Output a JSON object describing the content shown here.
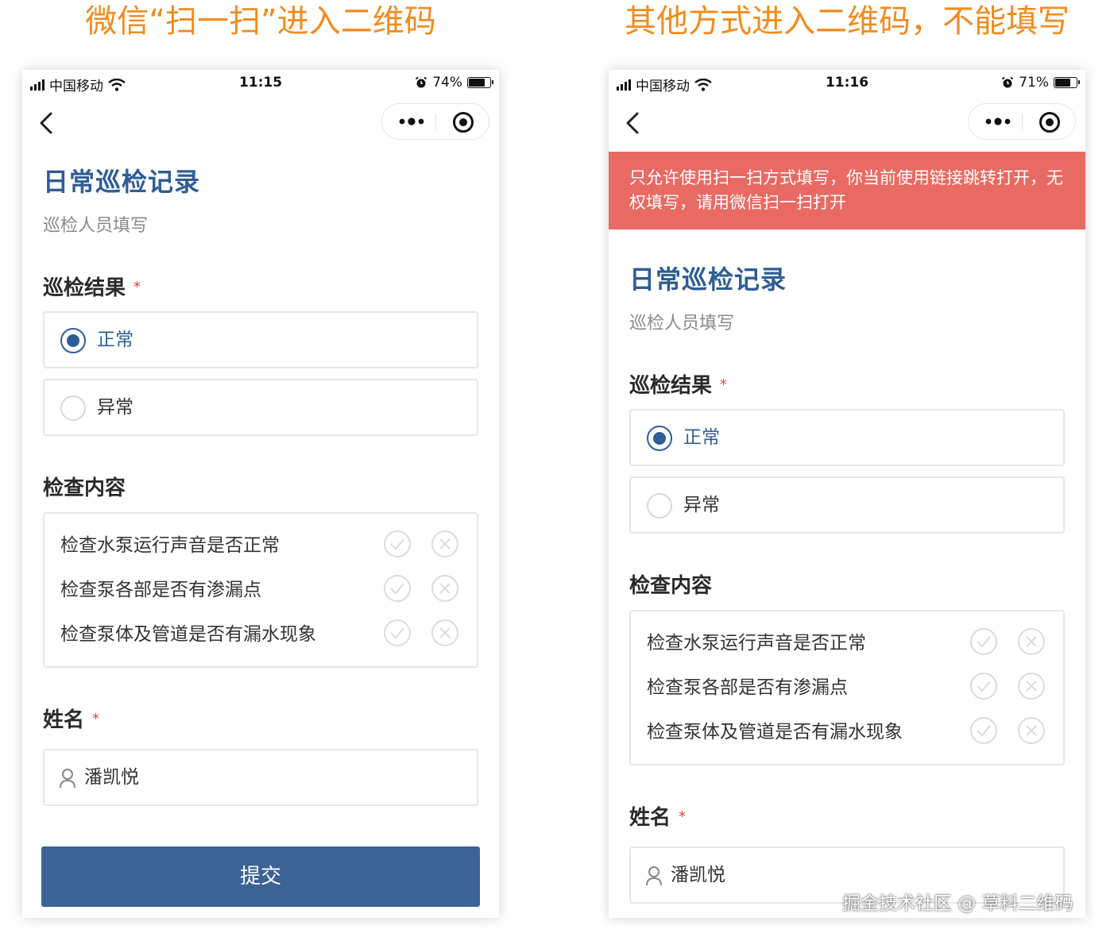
{
  "captions": {
    "left": "微信“扫一扫”进入二维码",
    "right": "其他方式进入二维码，不能填写"
  },
  "phones": [
    {
      "status": {
        "carrier": "中国移动",
        "time": "11:15",
        "battery": "74%",
        "battery_level": 0.74
      },
      "form": {
        "title": "日常巡检记录",
        "subtitle": "巡检人员填写",
        "result_label": "巡检结果",
        "required_mark": "*",
        "options": [
          "正常",
          "异常"
        ],
        "selected_option": "正常",
        "check_label": "检查内容",
        "check_items": [
          "检查水泵运行声音是否正常",
          "检查泵各部是否有渗漏点",
          "检查泵体及管道是否有漏水现象"
        ],
        "name_label": "姓名",
        "name_value": "潘凯悦",
        "submit_label": "提交"
      }
    },
    {
      "status": {
        "carrier": "中国移动",
        "time": "11:16",
        "battery": "71%",
        "battery_level": 0.71
      },
      "alert": "只允许使用扫一扫方式填写，你当前使用链接跳转打开，无权填写，请用微信扫一扫打开",
      "form": {
        "title": "日常巡检记录",
        "subtitle": "巡检人员填写",
        "result_label": "巡检结果",
        "required_mark": "*",
        "options": [
          "正常",
          "异常"
        ],
        "selected_option": "正常",
        "check_label": "检查内容",
        "check_items": [
          "检查水泵运行声音是否正常",
          "检查泵各部是否有渗漏点",
          "检查泵体及管道是否有漏水现象"
        ],
        "name_label": "姓名",
        "name_value": "潘凯悦"
      }
    }
  ],
  "watermark": "掘金技术社区 @ 草料二维码",
  "colors": {
    "caption": "#f08c1e",
    "brand_blue": "#2f5d95",
    "alert_bg": "#e86a63",
    "submit_bg": "#3b6396",
    "required": "#e0443b"
  }
}
